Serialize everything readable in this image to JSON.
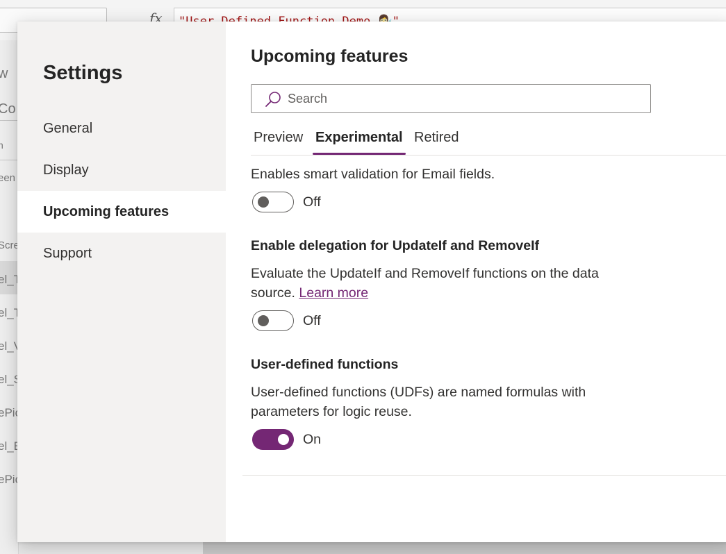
{
  "background": {
    "formula_text": "\"User Defined Function Demo 👩‍🔬\"",
    "fx_label": "fx",
    "tree_items": [
      "w",
      "Co",
      "n",
      "een",
      "Scre",
      "el_T",
      "el_T",
      "el_V",
      "el_S",
      "ePic",
      "el_E",
      "ePic"
    ]
  },
  "dialog": {
    "nav_title": "Settings",
    "nav_items": [
      {
        "label": "General"
      },
      {
        "label": "Display"
      },
      {
        "label": "Upcoming features"
      },
      {
        "label": "Support"
      }
    ],
    "active_nav": "Upcoming features",
    "content_title": "Upcoming features",
    "search": {
      "placeholder": "Search",
      "value": ""
    },
    "tabs": [
      {
        "label": "Preview"
      },
      {
        "label": "Experimental"
      },
      {
        "label": "Retired"
      }
    ],
    "active_tab": "Experimental",
    "features": [
      {
        "title": "",
        "description": "Enables smart validation for Email fields.",
        "state_label": "Off",
        "enabled": false
      },
      {
        "title": "Enable delegation for UpdateIf and RemoveIf",
        "description_line1": "Evaluate the UpdateIf and RemoveIf functions on the data",
        "description_line2": "source.",
        "link": "Learn more",
        "state_label": "Off",
        "enabled": false
      },
      {
        "title": "User-defined functions",
        "description_line1": "User-defined functions (UDFs) are named formulas with",
        "description_line2": "parameters for logic reuse.",
        "state_label": "On",
        "enabled": true
      }
    ]
  },
  "colors": {
    "accent": "#742774",
    "nav_background": "#f3f2f1",
    "toggle_off_border": "#605e5c"
  },
  "icons": [
    "search-icon",
    "fx-icon"
  ]
}
